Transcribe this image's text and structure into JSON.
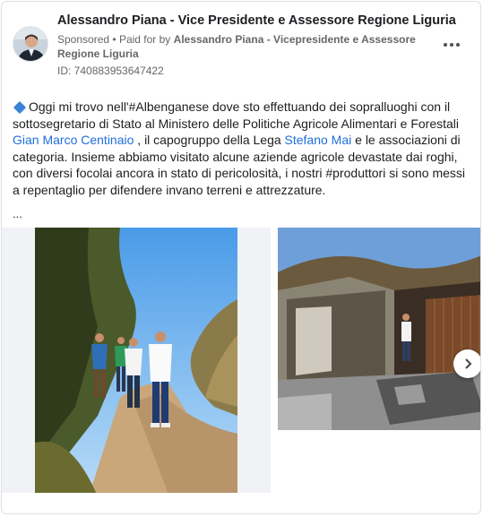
{
  "post": {
    "page_name": "Alessandro Piana - Vice Presidente e Assessore Regione Liguria",
    "sponsored_label": "Sponsored",
    "paid_for_prefix": "Paid for by",
    "funder": "Alessandro Piana - Vicepresidente e Assessore Regione Liguria",
    "ad_id": "ID: 740883953647422",
    "text": {
      "part1": "Oggi mi trovo nell'#Albenganese dove sto effettuando dei sopralluoghi con il sottosegretario di Stato al Ministero delle Politiche Agricole Alimentari e Forestali",
      "mention1": "Gian Marco Centinaio",
      "part2": ", il capogruppo della Lega",
      "mention2": "Stefano Mai",
      "part3": "e le associazioni di categoria. Insieme abbiamo visitato alcune aziende agricole devastate dai roghi, con diversi focolai ancora in stato di pericolosità, i nostri #produttori si sono messi a repentaglio per difendere invano terreni e attrezzature.",
      "ellipsis": "..."
    },
    "icons": [
      "blue-diamond-icon",
      "more-options-icon",
      "chevron-right-icon"
    ],
    "colors": {
      "link": "#216fdb",
      "secondary_text": "#65676b"
    }
  }
}
